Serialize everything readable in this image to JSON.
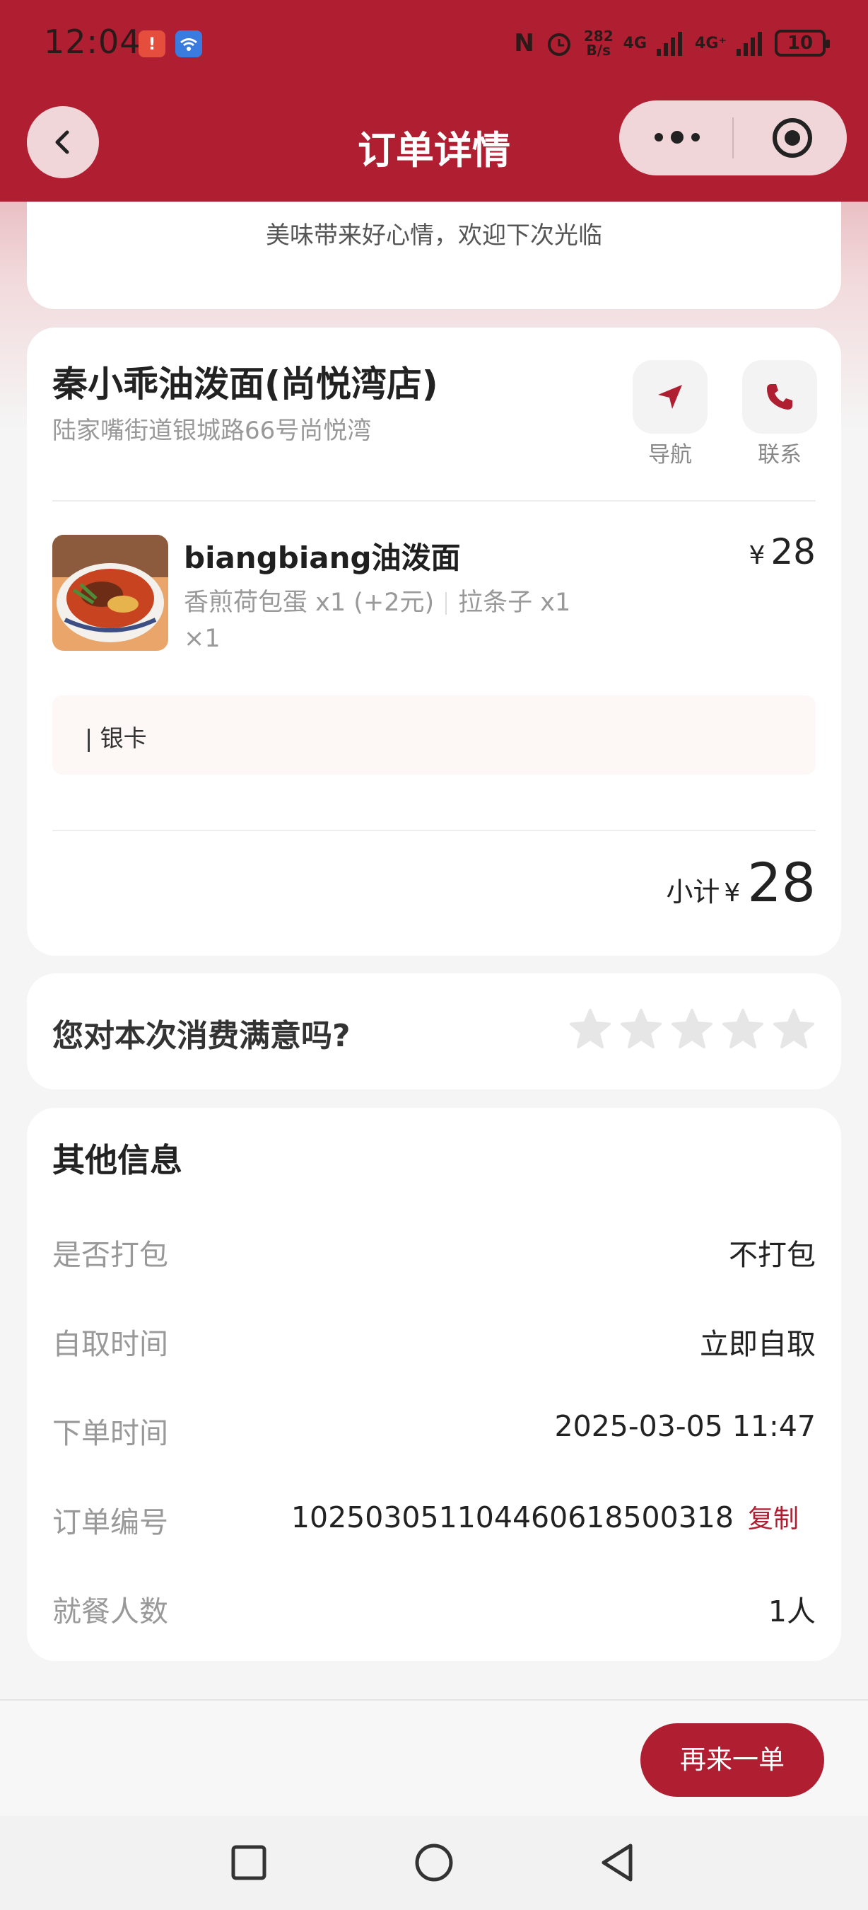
{
  "status_bar": {
    "time": "12:04",
    "notif_icon": "alert-app-icon",
    "wifi_icon": "wifi-app-icon",
    "nfc": "N",
    "net_speed_top": "282",
    "net_speed_bottom": "B/s",
    "sim1": "4G",
    "sim2": "4G⁺",
    "battery": "10"
  },
  "nav": {
    "title": "订单详情",
    "back_icon": "chevron-left-icon",
    "more_icon": "more-dots-icon",
    "close_icon": "target-icon"
  },
  "top_card": {
    "slogan": "美味带来好心情，欢迎下次光临"
  },
  "store": {
    "name": "秦小乖油泼面(尚悦湾店)",
    "address": "陆家嘴街道银城路66号尚悦湾",
    "navigate_label": "导航",
    "contact_label": "联系"
  },
  "order_item": {
    "name": "biangbiang油泼面",
    "spec1": "香煎荷包蛋 x1 (+2元)",
    "spec2": "拉条子 x1",
    "qty": "×1",
    "currency": "¥",
    "price": "28"
  },
  "remark": "| 银卡",
  "subtotal": {
    "label": "小计",
    "currency": "¥",
    "value": "28"
  },
  "rating": {
    "question": "您对本次消费满意吗?",
    "stars_total": 5,
    "stars_filled": 0
  },
  "other_info": {
    "title": "其他信息",
    "rows": [
      {
        "key": "是否打包",
        "value": "不打包"
      },
      {
        "key": "自取时间",
        "value": "立即自取"
      },
      {
        "key": "下单时间",
        "value": "2025-03-05 11:47"
      },
      {
        "key": "订单编号",
        "value": "102503051104460618500318"
      },
      {
        "key": "就餐人数",
        "value": "1人"
      }
    ],
    "copy_label": "复制"
  },
  "bottom": {
    "reorder_label": "再来一单"
  },
  "colors": {
    "brand": "#b01f31",
    "star_empty": "#e6e6e6"
  }
}
